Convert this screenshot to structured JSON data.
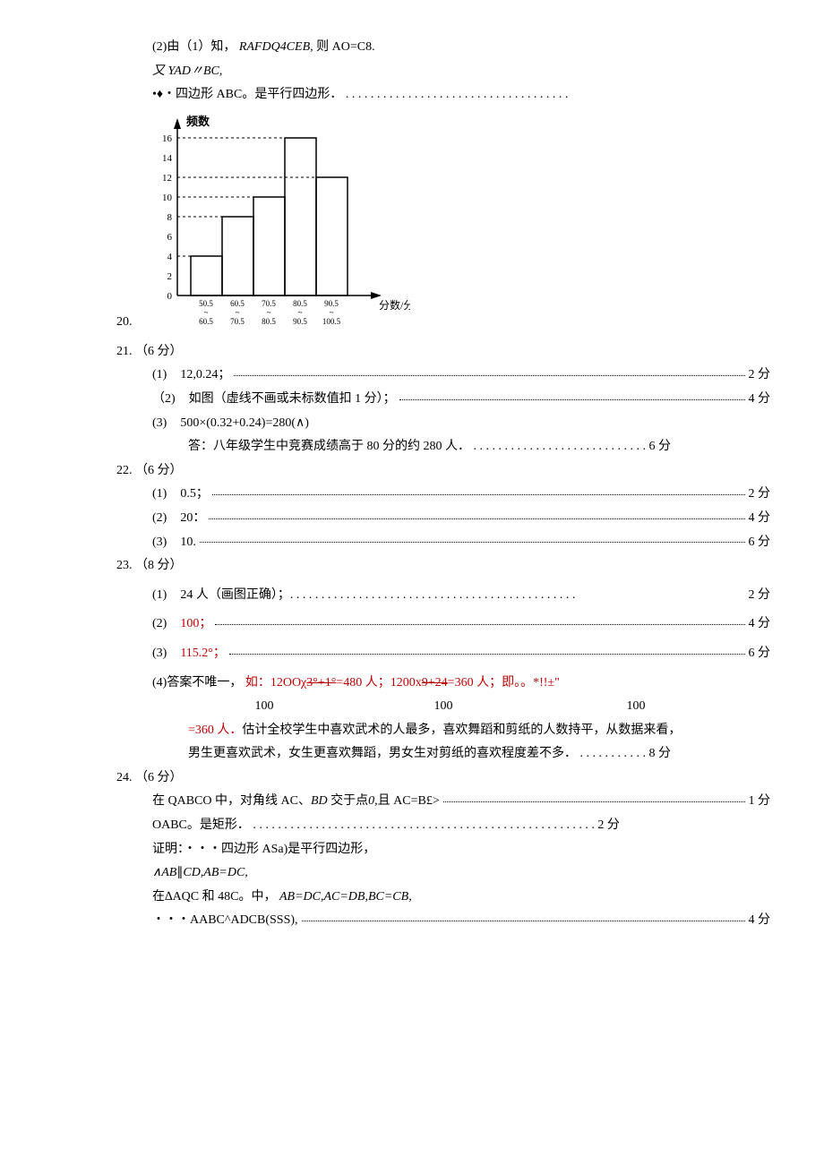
{
  "lines": {
    "l1a": "(2)由（1）知，",
    "l1b": "RAFDQ4CEB,",
    "l1c": "则 AO=C8.",
    "l2a": "又",
    "l2b": "YAD〃BC,",
    "l3a": "•♦・四边形 ABC。是平行四边形．",
    "l3dots": ". . . . . . . . . . . . . . . . . . . . . . . . . . . . . . . . . . . ."
  },
  "chart_data": {
    "type": "bar",
    "ylabel": "频数",
    "xlabel": "分数/分",
    "categories": [
      "50.5~60.5",
      "60.5~70.5",
      "70.5~80.5",
      "80.5~90.5",
      "90.5~100.5"
    ],
    "values": [
      4,
      8,
      10,
      16,
      12
    ],
    "yticks": [
      0,
      2,
      4,
      6,
      8,
      10,
      12,
      14,
      16
    ],
    "xtick_top": [
      "50.5",
      "60.5",
      "70.5",
      "80.5",
      "90.5"
    ],
    "xtick_bottom": [
      "60.5",
      "70.5",
      "80.5",
      "90.5",
      "100.5"
    ],
    "ylim": [
      0,
      16
    ]
  },
  "q20": {
    "num": "20."
  },
  "q21": {
    "num": "21.",
    "pts": "（6 分）",
    "s1": {
      "label": "(1)",
      "txt": "12,0.24；",
      "score": "2 分"
    },
    "s2": {
      "label": "（2)",
      "txt": "如图（虚线不画或未标数值扣 1 分）；",
      "score": "4 分"
    },
    "s3a": {
      "label": "(3)",
      "txt": "500×(0.32+0.24)=280(∧)"
    },
    "s3b": {
      "txt": "答：八年级学生中竞赛成绩高于 80 分的约 280 人．",
      "dots": ". . . . . . . . . . . . . . . . . . . . . . . . . . . .",
      "score": "6 分"
    }
  },
  "q22": {
    "num": "22.",
    "pts": "（6 分）",
    "s1": {
      "label": "(1)",
      "txt": "0.5；",
      "score": "2 分"
    },
    "s2": {
      "label": "(2)",
      "txt": "20：",
      "score": "4 分"
    },
    "s3": {
      "label": "(3)",
      "txt": "10.",
      "score": "6 分"
    }
  },
  "q23": {
    "num": "23.",
    "pts": "（8 分）",
    "s1": {
      "label": "(1)",
      "txt": "24 人（画图正确）；",
      "dots": ". . . . . . . . . . . . . . . . . . . . . . . . . . . . . . . . . . . . . . . . . . . . . .",
      "score": "2 分"
    },
    "s2": {
      "label": "(2)",
      "txt": "100；",
      "score": "4 分"
    },
    "s3": {
      "label": "(3)",
      "txt": "115.2°；",
      "score": "6 分"
    },
    "s4a": "(4)答案不唯一，",
    "s4b": "如：12OOχ",
    "s4c": "3°+1°",
    "s4d": "=480 人；1200x",
    "s4e": "9+24",
    "s4f": "=360 人；即。。*!!±\"",
    "fr": {
      "a": "100",
      "b": "100",
      "c": "100"
    },
    "s4g": "=360 人．估计全校学生中喜欢武术的人最多，喜欢舞蹈和剪纸的人数持平，从数据来看，",
    "s4h": "男生更喜欢武术，女生更喜欢舞蹈，男女生对剪纸的喜欢程度差不多．",
    "s4dots": ". . . . . . . . . . .",
    "s4score": "8 分"
  },
  "q24": {
    "num": "24.",
    "pts": "（6 分）",
    "l1": {
      "txt": "在 QABCO 中，对角线 AC、",
      "it": "BD",
      "txt2": " 交于点",
      "it2": "0,",
      "txt3": "且 AC=B£>",
      "score": "1 分"
    },
    "l2": {
      "txt": "OABC。是矩形．",
      "dots": ". . . . . . . . . . . . . . . . . . . . . . . . . . . . . . . . . . . . . . . . . . . . . . . . . . . . . . .",
      "score": "2 分"
    },
    "l3": "证明：・・・四边形 ASa)是平行四边形，",
    "l4a": "∧AB",
    "l4b": "∥",
    "l4c": "CD,AB=DC,",
    "l5a": "在∆AQC 和 48C。中，",
    "l5b": "AB=DC,AC=DB,BC=CB,",
    "l6": {
      "txt": "・・・AABC^ADCB(SSS),",
      "score": "4 分"
    }
  }
}
